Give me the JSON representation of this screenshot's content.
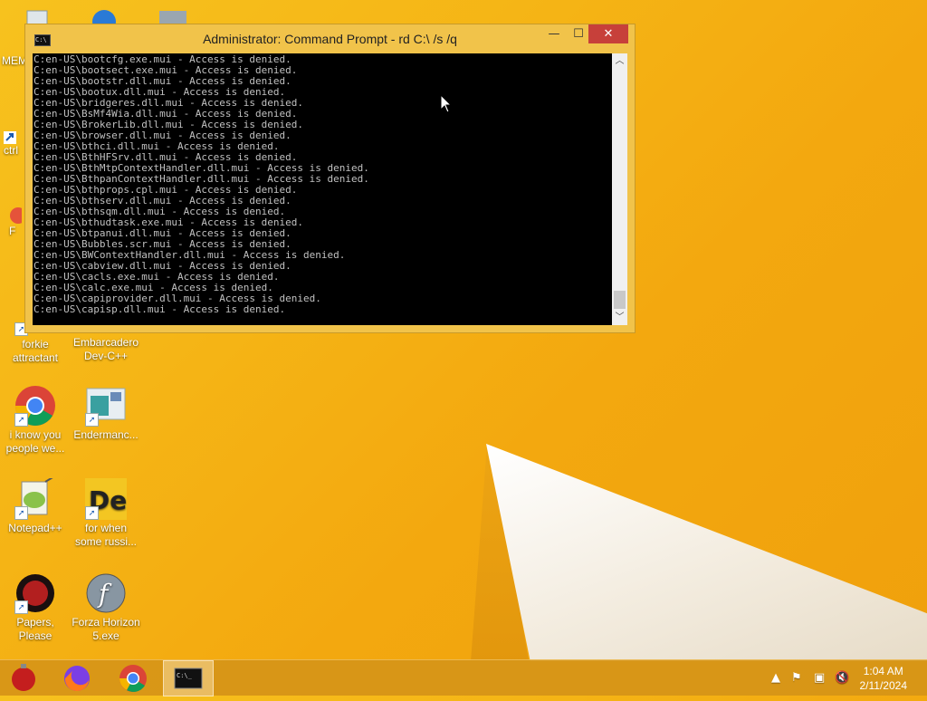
{
  "cmd_window": {
    "title": "Administrator: Command Prompt - rd  C:\\ /s /q",
    "lines": [
      "C:en-US\\bootcfg.exe.mui - Access is denied.",
      "C:en-US\\bootsect.exe.mui - Access is denied.",
      "C:en-US\\bootstr.dll.mui - Access is denied.",
      "C:en-US\\bootux.dll.mui - Access is denied.",
      "C:en-US\\bridgeres.dll.mui - Access is denied.",
      "C:en-US\\BsMf4Wia.dll.mui - Access is denied.",
      "C:en-US\\BrokerLib.dll.mui - Access is denied.",
      "C:en-US\\browser.dll.mui - Access is denied.",
      "C:en-US\\bthci.dll.mui - Access is denied.",
      "C:en-US\\BthHFSrv.dll.mui - Access is denied.",
      "C:en-US\\BthMtpContextHandler.dll.mui - Access is denied.",
      "C:en-US\\BthpanContextHandler.dll.mui - Access is denied.",
      "C:en-US\\bthprops.cpl.mui - Access is denied.",
      "C:en-US\\bthserv.dll.mui - Access is denied.",
      "C:en-US\\bthsqm.dll.mui - Access is denied.",
      "C:en-US\\bthudtask.exe.mui - Access is denied.",
      "C:en-US\\btpanui.dll.mui - Access is denied.",
      "C:en-US\\Bubbles.scr.mui - Access is denied.",
      "C:en-US\\BWContextHandler.dll.mui - Access is denied.",
      "C:en-US\\cabview.dll.mui - Access is denied.",
      "C:en-US\\cacls.exe.mui - Access is denied.",
      "C:en-US\\calc.exe.mui - Access is denied.",
      "C:en-US\\capiprovider.dll.mui - Access is denied.",
      "C:en-US\\capisp.dll.mui - Access is denied."
    ]
  },
  "desktop_icons": {
    "memz": "MEM",
    "ctrl": "ctrl",
    "f": "F",
    "forkie": "forkie attractant",
    "embarcadero": "Embarcadero Dev-C++",
    "chrome": "i know you people we...",
    "endermanch": "Endermanc...",
    "notepadpp": "Notepad++",
    "russian": "for when some russi...",
    "papers": "Papers, Please",
    "forza": "Forza Horizon 5.exe"
  },
  "clock": {
    "time": "1:04 AM",
    "date": "2/11/2024"
  },
  "colors": {
    "accent": "#f5b415",
    "close": "#c7403a",
    "console_bg": "#000000",
    "console_text": "#c0c0c0"
  }
}
